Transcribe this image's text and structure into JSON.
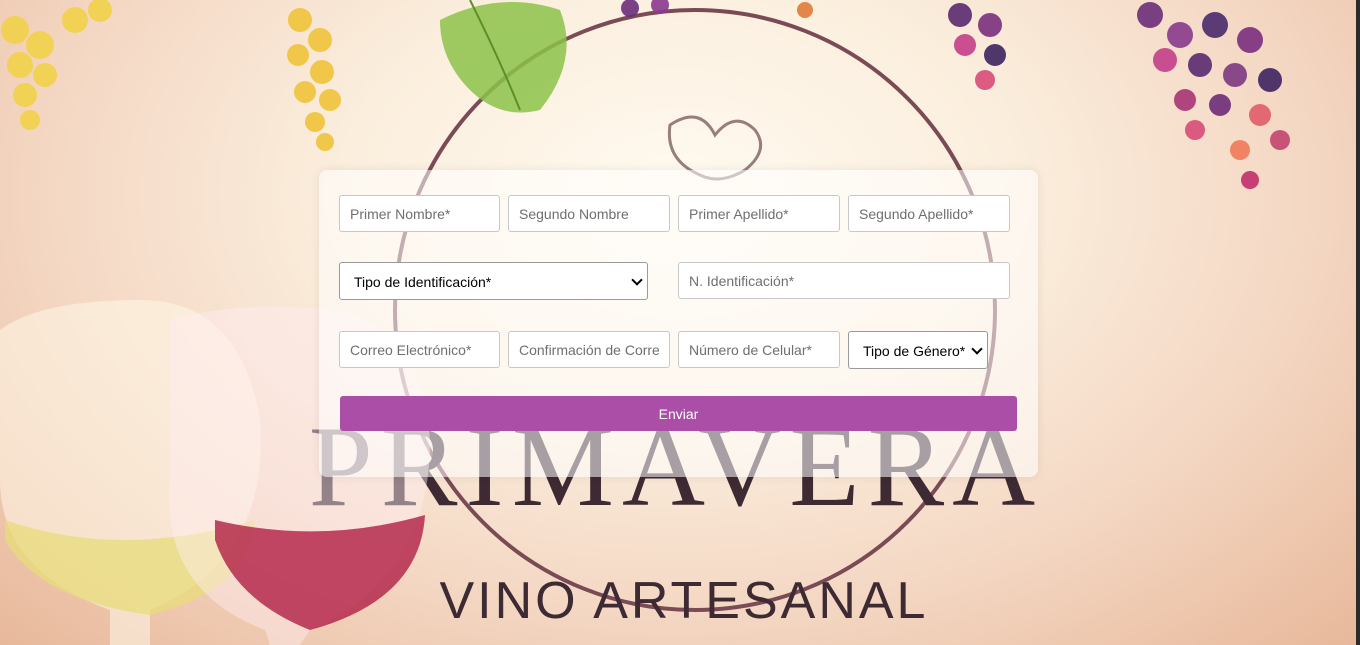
{
  "background": {
    "brand_title": "PRIMAVERA",
    "brand_subtitle": "VINO ARTESANAL"
  },
  "form": {
    "primer_nombre_placeholder": "Primer Nombre*",
    "segundo_nombre_placeholder": "Segundo Nombre",
    "primer_apellido_placeholder": "Primer Apellido*",
    "segundo_apellido_placeholder": "Segundo Apellido*",
    "tipo_identificacion_selected": "Tipo de Identificación*",
    "n_identificacion_placeholder": "N. Identificación*",
    "correo_placeholder": "Correo Electrónico*",
    "confirmacion_correo_placeholder": "Confirmación de Correo",
    "numero_celular_placeholder": "Número de Celular*",
    "tipo_genero_selected": "Tipo de Género*",
    "submit_label": "Enviar"
  },
  "colors": {
    "accent": "#ab4ea8",
    "brand_text": "#3d2a33"
  }
}
